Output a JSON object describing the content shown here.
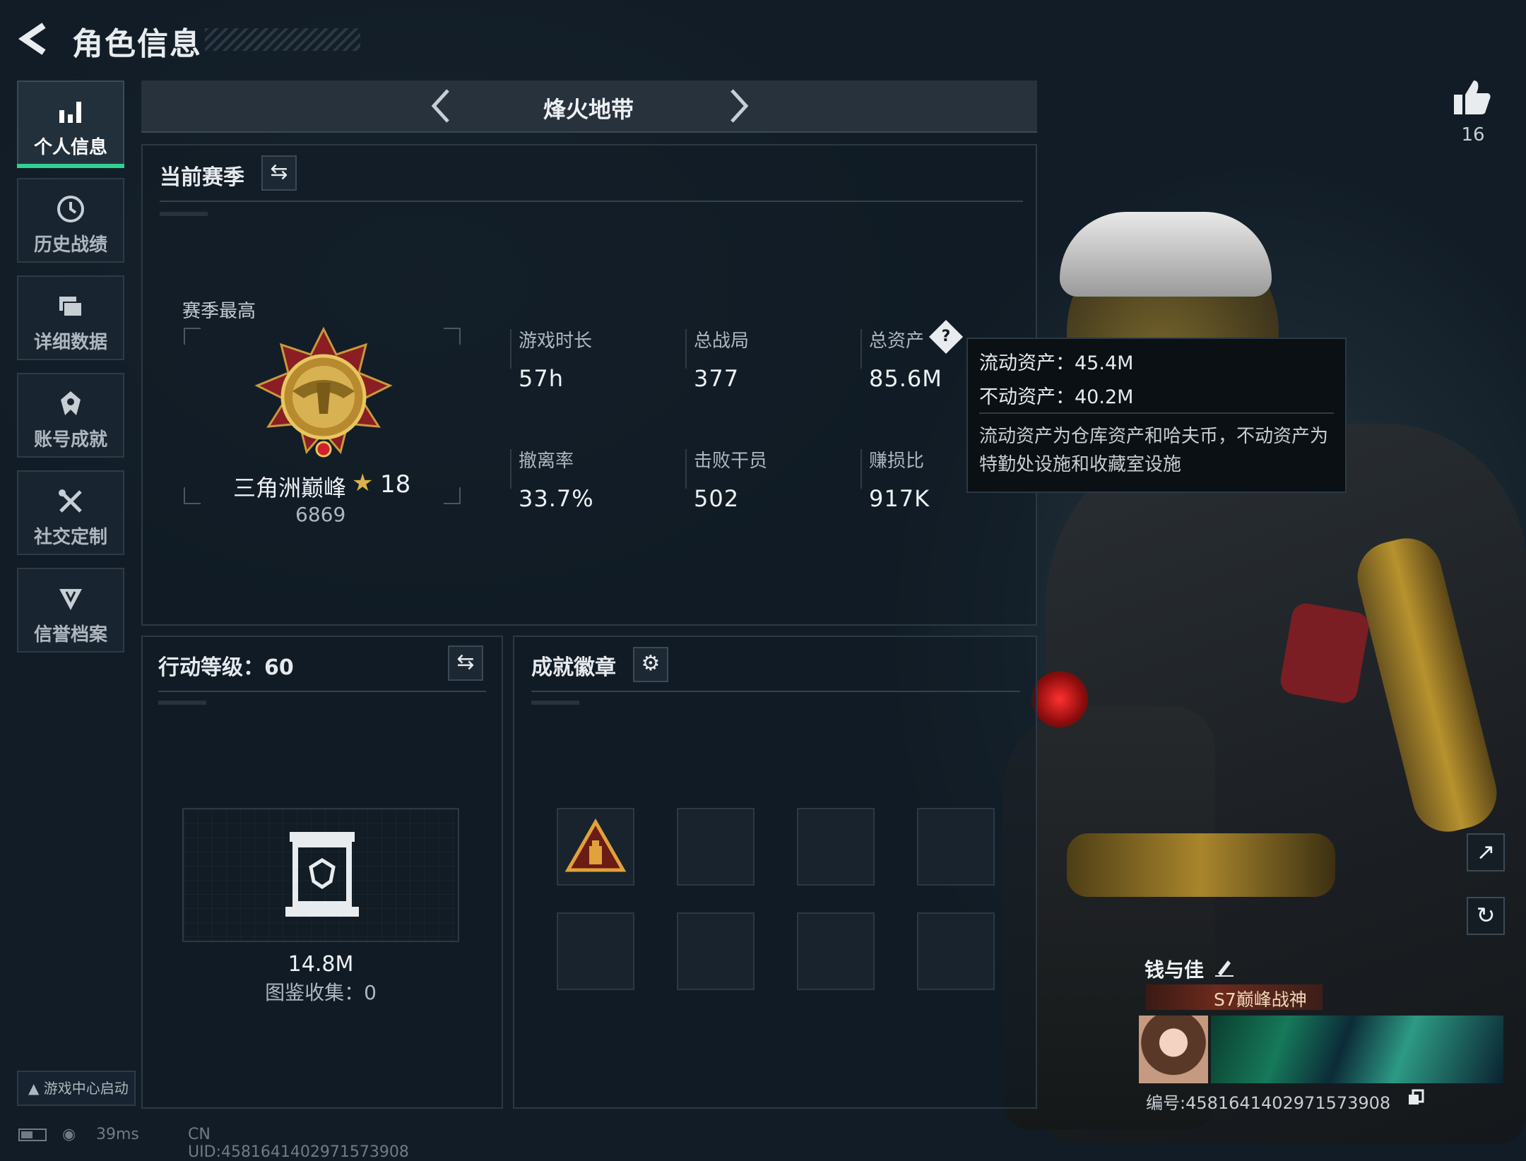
{
  "header": {
    "title": "角色信息"
  },
  "sidebar": {
    "items": [
      {
        "label": "个人信息",
        "icon": "bar-chart-icon",
        "active": true
      },
      {
        "label": "历史战绩",
        "icon": "history-clock-icon",
        "active": false
      },
      {
        "label": "详细数据",
        "icon": "folder-icon",
        "active": false
      },
      {
        "label": "账号成就",
        "icon": "achievement-icon",
        "active": false
      },
      {
        "label": "社交定制",
        "icon": "tools-icon",
        "active": false
      },
      {
        "label": "信誉档案",
        "icon": "credit-shield-icon",
        "active": false
      }
    ],
    "game_center": "游戏中心启动"
  },
  "mode": {
    "name": "烽火地带"
  },
  "season": {
    "title": "当前赛季",
    "best_label": "赛季最高",
    "rank_name": "三角洲巅峰",
    "rank_stars": "18",
    "rank_score": "6869",
    "stats": [
      {
        "label": "游戏时长",
        "value": "57h"
      },
      {
        "label": "总战局",
        "value": "377"
      },
      {
        "label": "总资产",
        "value": "85.6M"
      },
      {
        "label": "撤离率",
        "value": "33.7%"
      },
      {
        "label": "击败干员",
        "value": "502"
      },
      {
        "label": "赚损比",
        "value": "917K"
      }
    ]
  },
  "tooltip": {
    "liquid": "流动资产：45.4M",
    "fixed": "不动资产：40.2M",
    "desc": "流动资产为仓库资产和哈夫币，不动资产为特勤处设施和收藏室设施"
  },
  "action": {
    "title": "行动等级：60",
    "codex_value": "14.8M",
    "codex_count": "图鉴收集：0"
  },
  "badges": {
    "title": "成就徽章",
    "filled_slots": 1,
    "total_slots": 8
  },
  "likes": {
    "count": "16"
  },
  "player": {
    "name": "钱与佳",
    "title": "S7巅峰战神",
    "id": "编号:4581641402971573908"
  },
  "status": {
    "ping": "39ms",
    "uid": "CN UID:4581641402971573908"
  },
  "colors": {
    "accent": "#2fd28f",
    "gold": "#d9b24a",
    "background": "#111c26"
  }
}
